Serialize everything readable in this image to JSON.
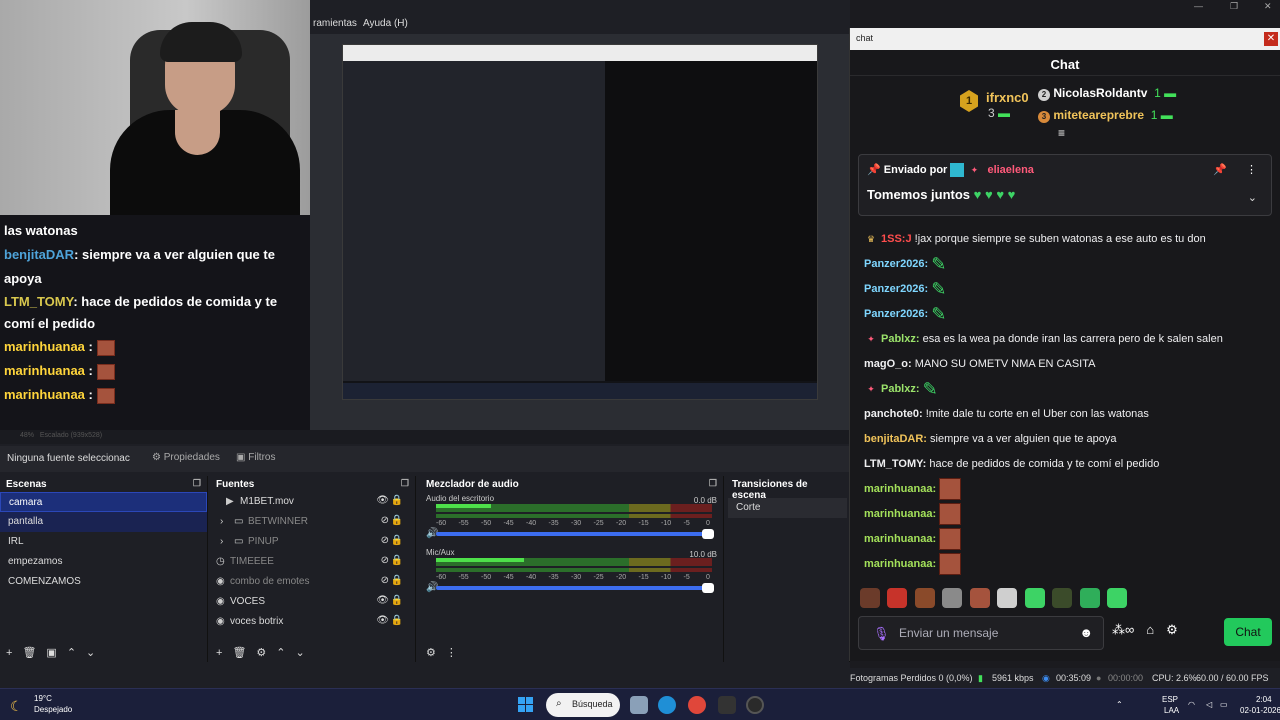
{
  "menubar": {
    "items": [
      "ramientas",
      "Ayuda (H)"
    ]
  },
  "overlay_chat": {
    "lines": [
      {
        "user": "",
        "text": "las watonas"
      },
      {
        "user": "benjitaDAR",
        "text": ": siempre va a ver alguien que te apoya"
      },
      {
        "user": "LTM_TOMY",
        "text": ": hace de pedidos de comida y te comí el pedido"
      },
      {
        "user": "marinhuanaa",
        "text": " :"
      },
      {
        "user": "marinhuanaa",
        "text": " :"
      },
      {
        "user": "marinhuanaa",
        "text": " :"
      }
    ]
  },
  "preview_status": {
    "zoom": "48%",
    "scale": "Escalado (939x528)"
  },
  "source_toolbar": {
    "no_source": "Ninguna fuente seleccionac",
    "properties": "Propiedades",
    "filters": "Filtros"
  },
  "docks": {
    "scenes_title": "Escenas",
    "sources_title": "Fuentes",
    "mixer_title": "Mezclador de audio",
    "transitions_title": "Transiciones de escena"
  },
  "scenes": [
    "camara",
    "pantalla",
    "IRL",
    "empezamos",
    "COMENZAMOS"
  ],
  "sources": [
    {
      "name": "M1BET.mov",
      "icon": "play-icon",
      "visible": true
    },
    {
      "name": "BETWINNER",
      "icon": "folder-icon",
      "visible": false
    },
    {
      "name": "PINUP",
      "icon": "folder-icon",
      "visible": false
    },
    {
      "name": "TIMEEEE",
      "icon": "clock-icon",
      "visible": false
    },
    {
      "name": "combo de emotes",
      "icon": "scene-icon",
      "visible": false
    },
    {
      "name": "VOCES",
      "icon": "scene-icon",
      "visible": true
    },
    {
      "name": "voces botrix",
      "icon": "scene-icon",
      "visible": true
    }
  ],
  "mixer": {
    "channels": [
      {
        "name": "Audio del escritorio",
        "db": "0.0 dB",
        "level": 0.2
      },
      {
        "name": "Mic/Aux",
        "db": "10.0 dB",
        "level": 0.32
      }
    ],
    "scale": [
      "-60",
      "-55",
      "-50",
      "-45",
      "-40",
      "-35",
      "-30",
      "-25",
      "-20",
      "-15",
      "-10",
      "-5",
      "0"
    ]
  },
  "transitions": {
    "selected": "Corte"
  },
  "obs_status": {
    "dropped": "Fotogramas Perdidos 0 (0,0%)",
    "kbps": "5961 kbps",
    "stream_time": "00:35:09",
    "rec_time": "00:00:00",
    "cpu": "CPU: 2.6%",
    "fps": "60.00 / 60.00 FPS"
  },
  "chat": {
    "window_title": "chat",
    "header": "Chat",
    "leaderboard": [
      {
        "rank": "1",
        "name": "ifrxnc0",
        "count": "3",
        "color": "#d6a21e"
      },
      {
        "rank": "2",
        "name": "NicolasRoldantv",
        "count": "1",
        "color": "#cfcfcf"
      },
      {
        "rank": "3",
        "name": "miteteareprebre",
        "count": "1",
        "color": "#d88a3a"
      }
    ],
    "pinned": {
      "label": "Enviado por",
      "user": "eliaelena",
      "message": "Tomemos juntos",
      "hearts": "♥ ♥ ♥ ♥"
    },
    "messages": [
      {
        "user": "1SS:J",
        "color": "#ff4d4d",
        "text": " !jax porque siempre se suben watonas a ese auto es tu don",
        "emotes": 0
      },
      {
        "user": "Panzer2026:",
        "color": "#7fd6ff",
        "text": "",
        "emotes": 1
      },
      {
        "user": "Panzer2026:",
        "color": "#7fd6ff",
        "text": "",
        "emotes": 1
      },
      {
        "user": "Panzer2026:",
        "color": "#7fd6ff",
        "text": "",
        "emotes": 1
      },
      {
        "user": "Pablxz:",
        "color": "#9be36b",
        "text": " esa es la wea pa donde iran las carrera pero de k salen salen",
        "emotes": 0
      },
      {
        "user": "magO_o:",
        "color": "#efeff1",
        "text": " MANO SU OMETV NMA EN CASITA",
        "emotes": 0
      },
      {
        "user": "Pablxz:",
        "color": "#9be36b",
        "text": "",
        "emotes": 1
      },
      {
        "user": "panchote0:",
        "color": "#efeff1",
        "text": " !mite dale tu corte en el Uber con las watonas",
        "emotes": 0
      },
      {
        "user": "benjitaDAR:",
        "color": "#f0c35a",
        "text": " siempre va a ver alguien que te apoya",
        "emotes": 0
      },
      {
        "user": "LTM_TOMY:",
        "color": "#efeff1",
        "text": " hace de pedidos de comida y te comí el pedido",
        "emotes": 0
      },
      {
        "user": "marinhuanaa:",
        "color": "#a3e05a",
        "text": "",
        "emotes": 1
      },
      {
        "user": "marinhuanaa:",
        "color": "#a3e05a",
        "text": "",
        "emotes": 1
      },
      {
        "user": "marinhuanaa:",
        "color": "#a3e05a",
        "text": "",
        "emotes": 1
      },
      {
        "user": "marinhuanaa:",
        "color": "#a3e05a",
        "text": "",
        "emotes": 1
      }
    ],
    "input_placeholder": "Enviar un mensaje",
    "send_label": "Chat"
  },
  "taskbar": {
    "temp": "19°C",
    "weather": "Despejado",
    "search": "Búsqueda",
    "lang": "ESP",
    "region": "LAA",
    "time": "2:04",
    "date": "02-01-2026"
  },
  "colors": {
    "accent": "#22c95c",
    "obs_select": "#1c2f7a",
    "twitch_purple": "#a970ff"
  }
}
